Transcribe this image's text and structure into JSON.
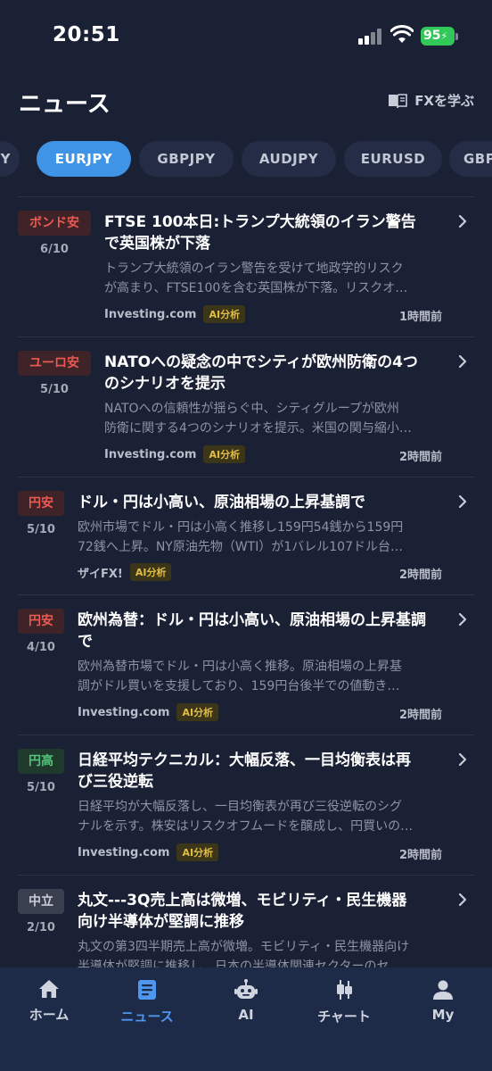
{
  "status_bar": {
    "time": "20:51",
    "battery": "95"
  },
  "header": {
    "title": "ニュース",
    "learn_link": "FXを学ぶ"
  },
  "tabs": [
    "PY",
    "EURJPY",
    "GBPJPY",
    "AUDJPY",
    "EURUSD",
    "GBP"
  ],
  "active_tab": "EURJPY",
  "news": [
    {
      "badge": "ボンド安",
      "badge_color": "red",
      "fraction": "6/10",
      "headline_lines": [
        "FTSE 100本日:トランプ大統領のイラン警告",
        "で英国株が下落"
      ],
      "summary_lines": [
        "トランプ大統領のイラン警告を受けて地政学的リスク",
        "が高まり、FTSE100を含む英国株が下落。リスクオ…"
      ],
      "source": "Investing.com",
      "tag": "AI分析",
      "time": "1時間前"
    },
    {
      "badge": "ユーロ安",
      "badge_color": "red",
      "fraction": "5/10",
      "headline_lines": [
        "NATOへの疑念の中でシティが欧州防衛の4つ",
        "のシナリオを提示"
      ],
      "summary_lines": [
        "NATOへの信頼性が揺らぐ中、シティグループが欧州",
        "防衛に関する4つのシナリオを提示。米国の関与縮小…"
      ],
      "source": "Investing.com",
      "tag": "AI分析",
      "time": "2時間前"
    },
    {
      "badge": "円安",
      "badge_color": "red",
      "fraction": "5/10",
      "headline_lines": [
        "ドル・円は小高い、原油相場の上昇基調で"
      ],
      "summary_lines": [
        "欧州市場でドル・円は小高く推移し159円54銭から159円",
        "72銭へ上昇。NY原油先物（WTI）が1バレル107ドル台…"
      ],
      "source": "ザイFX!",
      "tag": "AI分析",
      "time": "2時間前"
    },
    {
      "badge": "円安",
      "badge_color": "red",
      "fraction": "4/10",
      "headline_lines": [
        "欧州為替：ドル・円は小高い、原油相場の上昇基調",
        "で"
      ],
      "summary_lines": [
        "欧州為替市場でドル・円は小高く推移。原油相場の上昇基",
        "調がドル買いを支援しており、159円台後半での値動き…"
      ],
      "source": "Investing.com",
      "tag": "AI分析",
      "time": "2時間前"
    },
    {
      "badge": "円高",
      "badge_color": "green",
      "fraction": "5/10",
      "headline_lines": [
        "日経平均テクニカル：大幅反落、一目均衡表は再",
        "び三役逆転"
      ],
      "summary_lines": [
        "日経平均が大幅反落し、一目均衡表が再び三役逆転のシグ",
        "ナルを示す。株安はリスクオフムードを醸成し、円買いの…"
      ],
      "source": "Investing.com",
      "tag": "AI分析",
      "time": "2時間前"
    },
    {
      "badge": "中立",
      "badge_color": "grey",
      "fraction": "2/10",
      "headline_lines": [
        "丸文---3Q売上高は微増、モビリティ・民生機器",
        "向け半導体が堅調に推移"
      ],
      "summary_lines": [
        "丸文の第3四半期売上高が微増。モビリティ・民生機器向け",
        "半導体が堅調に推移し、日本の半導体関連セクターのセ…"
      ],
      "source": "",
      "tag": "",
      "time": ""
    }
  ],
  "bottom_nav": [
    "ホーム",
    "ニュース",
    "AI",
    "チャート",
    "My"
  ],
  "active_nav": "ニュース",
  "colors": {
    "background": "#1b2135",
    "accent": "#3f94e6",
    "tab_bar": "#1d2a48",
    "bearish": "#ec5a52",
    "bullish": "#53c47a",
    "ai_tag": "#e2bd45"
  }
}
